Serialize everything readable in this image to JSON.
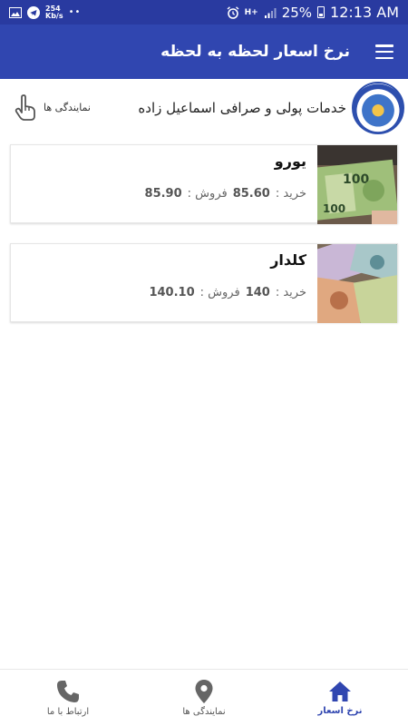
{
  "status_bar": {
    "net_speed_value": "254",
    "net_speed_unit": "Kb/s",
    "dots": "••",
    "network_label": "H+",
    "battery": "25%",
    "time": "12:13 AM"
  },
  "app_bar": {
    "title": "نرخ اسعار لحظه به لحظه"
  },
  "brand": {
    "name": "خدمات پولی و صرافی اسماعیل زاده",
    "agencies_label": "نمایندگی ها"
  },
  "currencies": [
    {
      "name": "یورو",
      "buy_label": "خرید :",
      "buy": "85.60",
      "sell_label": "فروش :",
      "sell": "85.90"
    },
    {
      "name": "کلدار",
      "buy_label": "خرید :",
      "buy": "140",
      "sell_label": "فروش :",
      "sell": "140.10"
    }
  ],
  "bottom_nav": {
    "items": [
      {
        "label": "نرخ اسعار",
        "icon": "home-icon",
        "active": true
      },
      {
        "label": "نمایندگی ها",
        "icon": "location-pin-icon",
        "active": false
      },
      {
        "label": "ارتباط با ما",
        "icon": "phone-icon",
        "active": false
      }
    ]
  },
  "colors": {
    "status_bar": "#293aa0",
    "app_bar": "#3046b0",
    "active_nav": "#3046b0"
  }
}
